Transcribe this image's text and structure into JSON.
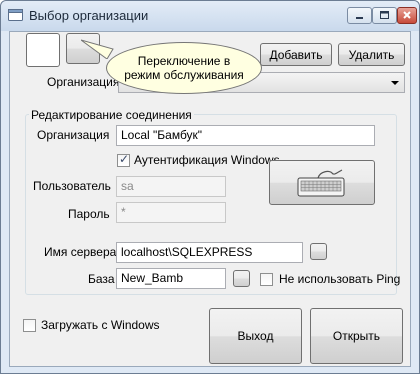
{
  "window": {
    "title": "Выбор организации"
  },
  "toolbar": {
    "add_label": "Добавить",
    "delete_label": "Удалить"
  },
  "org_select": {
    "label": "Организация",
    "value": ""
  },
  "tooltip": {
    "line1": "Переключение в",
    "line2": "режим обслуживания"
  },
  "connection": {
    "group_title": "Редактирование соединения",
    "org_label": "Организация",
    "org_value": "Local \"Бамбук\"",
    "windows_auth_label": "Аутентификация Windows",
    "windows_auth_checked": true,
    "user_label": "Пользователь",
    "user_value": "sa",
    "password_label": "Пароль",
    "password_value": "*",
    "server_label": "Имя сервера",
    "server_value": "localhost\\SQLEXPRESS",
    "db_label": "База",
    "db_value": "New_Bamb",
    "no_ping_label": "Не использовать Ping",
    "no_ping_checked": false
  },
  "footer": {
    "load_windows_label": "Загружать с Windows",
    "load_windows_checked": false,
    "exit_label": "Выход",
    "open_label": "Открыть"
  },
  "icons": {
    "app": "window-icon",
    "keyboard": "keyboard-icon"
  }
}
